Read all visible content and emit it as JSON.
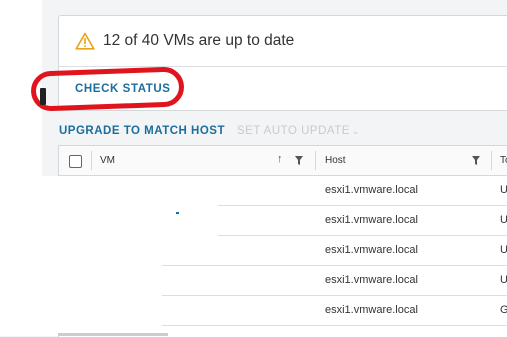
{
  "summary": {
    "text": "12 of 40 VMs are up to date",
    "icon": "warning-triangle-icon",
    "icon_color": "#e8a317"
  },
  "actions": {
    "check_status": "CHECK STATUS"
  },
  "toolbar": {
    "upgrade_label": "UPGRADE TO MATCH HOST",
    "auto_update_label": "SET AUTO UPDATE"
  },
  "table": {
    "columns": {
      "vm": "VM",
      "host": "Host",
      "status": "To"
    },
    "rows": [
      {
        "host": "esxi1.vmware.local",
        "status": "U"
      },
      {
        "host": "esxi1.vmware.local",
        "status": "U"
      },
      {
        "host": "esxi1.vmware.local",
        "status": "U"
      },
      {
        "host": "esxi1.vmware.local",
        "status": "U"
      },
      {
        "host": "esxi1.vmware.local",
        "status": "G"
      }
    ]
  },
  "colors": {
    "link": "#1a6e9d",
    "annotation": "#e0141c",
    "disabled": "#c7cbcf"
  }
}
